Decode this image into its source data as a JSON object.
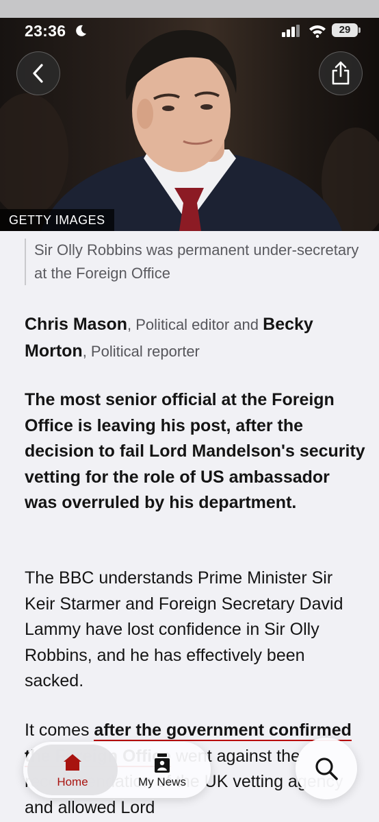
{
  "status_bar": {
    "time": "23:36",
    "battery": "29"
  },
  "hero": {
    "credit": "GETTY IMAGES"
  },
  "article": {
    "caption": "Sir Olly Robbins was permanent under-secretary at the Foreign Office",
    "byline": {
      "author1": "Chris Mason",
      "role1": ", Political editor and ",
      "author2": "Becky Morton",
      "role2": ", Political reporter"
    },
    "lede": "The most senior official at the Foreign Office is leaving his post, after the decision to  fail Lord Mandelson's security vetting for the role of US ambassador was overruled by his department.",
    "paragraph1": "The BBC understands Prime Minister Sir Keir Starmer and Foreign Secretary David Lammy have lost confidence in Sir Olly Robbins, and he has effectively been sacked.",
    "paragraph2_start": "It comes ",
    "paragraph2_link": "after the government confirmed the Foreign Office",
    "paragraph2_rest": " went against the recommendation of the UK vetting agency and allowed Lord"
  },
  "tab_bar": {
    "home_label": "Home",
    "mynews_label": "My News"
  },
  "colors": {
    "accent": "#b80000",
    "background": "#f1f1f5"
  }
}
